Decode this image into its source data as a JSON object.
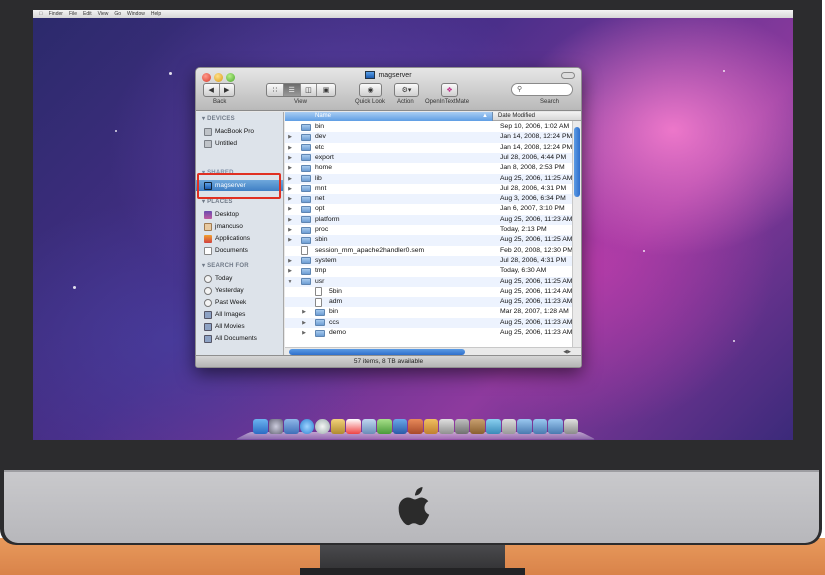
{
  "finder": {
    "title": "magserver",
    "toolbar": {
      "back_label": "Back",
      "view_label": "View",
      "quicklook_label": "Quick Look",
      "action_label": "Action",
      "openintextmate_label": "OpenInTextMate",
      "search_label": "Search"
    },
    "sidebar": {
      "devices_header": "DEVICES",
      "devices": [
        "MacBook Pro",
        "Untitled"
      ],
      "shared_header": "SHARED",
      "shared": [
        "magserver"
      ],
      "places_header": "PLACES",
      "places": [
        "Desktop",
        "jmancuso",
        "Applications",
        "Documents"
      ],
      "search_header": "SEARCH FOR",
      "searches": [
        "Today",
        "Yesterday",
        "Past Week",
        "All Images",
        "All Movies",
        "All Documents"
      ]
    },
    "columns": {
      "name": "Name",
      "date": "Date Modified"
    },
    "rows": [
      {
        "name": "bin",
        "date": "Sep 10, 2006, 1:02 AM",
        "type": "folder-link",
        "indent": 0,
        "expanded": false,
        "expandable": false
      },
      {
        "name": "dev",
        "date": "Jan 14, 2008, 12:24 PM",
        "type": "folder",
        "indent": 0,
        "expanded": false,
        "expandable": true
      },
      {
        "name": "etc",
        "date": "Jan 14, 2008, 12:24 PM",
        "type": "folder",
        "indent": 0,
        "expanded": false,
        "expandable": true
      },
      {
        "name": "export",
        "date": "Jul 28, 2006, 4:44 PM",
        "type": "folder",
        "indent": 0,
        "expanded": false,
        "expandable": true
      },
      {
        "name": "home",
        "date": "Jan 8, 2008, 2:53 PM",
        "type": "folder",
        "indent": 0,
        "expanded": false,
        "expandable": true
      },
      {
        "name": "lib",
        "date": "Aug 25, 2006, 11:25 AM",
        "type": "folder",
        "indent": 0,
        "expanded": false,
        "expandable": true
      },
      {
        "name": "mnt",
        "date": "Jul 28, 2006, 4:31 PM",
        "type": "folder",
        "indent": 0,
        "expanded": false,
        "expandable": true
      },
      {
        "name": "net",
        "date": "Aug 3, 2006, 6:34 PM",
        "type": "folder",
        "indent": 0,
        "expanded": false,
        "expandable": true
      },
      {
        "name": "opt",
        "date": "Jan 6, 2007, 3:10 PM",
        "type": "folder",
        "indent": 0,
        "expanded": false,
        "expandable": true
      },
      {
        "name": "platform",
        "date": "Aug 25, 2006, 11:23 AM",
        "type": "folder",
        "indent": 0,
        "expanded": false,
        "expandable": true
      },
      {
        "name": "proc",
        "date": "Today, 2:13 PM",
        "type": "folder",
        "indent": 0,
        "expanded": false,
        "expandable": true
      },
      {
        "name": "sbin",
        "date": "Aug 25, 2006, 11:25 AM",
        "type": "folder",
        "indent": 0,
        "expanded": false,
        "expandable": true
      },
      {
        "name": "session_mm_apache2handler0.sem",
        "date": "Feb 20, 2008, 12:30 PM",
        "type": "document",
        "indent": 0,
        "expanded": false,
        "expandable": false
      },
      {
        "name": "system",
        "date": "Jul 28, 2006, 4:31 PM",
        "type": "folder",
        "indent": 0,
        "expanded": false,
        "expandable": true
      },
      {
        "name": "tmp",
        "date": "Today, 6:30 AM",
        "type": "folder",
        "indent": 0,
        "expanded": false,
        "expandable": true
      },
      {
        "name": "usr",
        "date": "Aug 25, 2006, 11:25 AM",
        "type": "folder",
        "indent": 0,
        "expanded": true,
        "expandable": true
      },
      {
        "name": "5bin",
        "date": "Aug 25, 2006, 11:24 AM",
        "type": "document",
        "indent": 1,
        "expanded": false,
        "expandable": false
      },
      {
        "name": "adm",
        "date": "Aug 25, 2006, 11:23 AM",
        "type": "document",
        "indent": 1,
        "expanded": false,
        "expandable": false
      },
      {
        "name": "bin",
        "date": "Mar 28, 2007, 1:28 AM",
        "type": "folder",
        "indent": 1,
        "expanded": false,
        "expandable": true
      },
      {
        "name": "ccs",
        "date": "Aug 25, 2006, 11:23 AM",
        "type": "folder",
        "indent": 1,
        "expanded": false,
        "expandable": true
      },
      {
        "name": "demo",
        "date": "Aug 25, 2006, 11:23 AM",
        "type": "folder",
        "indent": 1,
        "expanded": false,
        "expandable": true
      }
    ],
    "status": "57 items, 8 TB available"
  },
  "colors": {
    "selection_blue": "#3f7fc4",
    "highlight_red": "#e03022",
    "row_alt": "#edf3fe"
  }
}
